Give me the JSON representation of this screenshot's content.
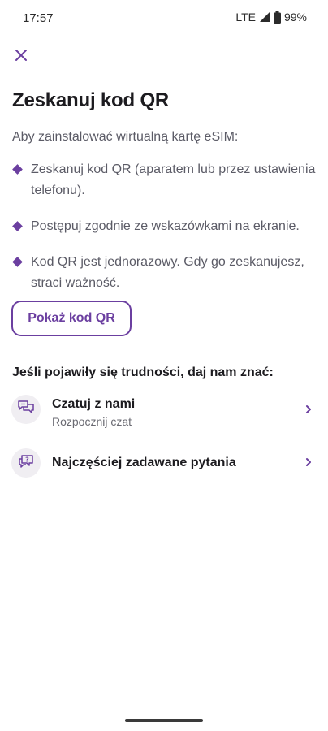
{
  "status_bar": {
    "time": "17:57",
    "network": "LTE",
    "battery": "99%",
    "icons": [
      "signal-icon",
      "battery-icon"
    ]
  },
  "header": {
    "close_icon": "close-icon",
    "title": "Zeskanuj kod QR"
  },
  "instructions": {
    "intro": "Aby zainstalować wirtualną kartę eSIM:",
    "items": [
      "Zeskanuj kod QR (aparatem lub przez ustawienia telefonu).",
      "Postępuj zgodnie ze wskazówkami na ekranie.",
      "Kod QR jest jednorazowy. Gdy go zeskanujesz, straci ważność."
    ]
  },
  "actions": {
    "show_qr_label": "Pokaż kod QR"
  },
  "help": {
    "title": "Jeśli pojawiły się trudności, daj nam znać:",
    "items": [
      {
        "label": "Czatuj z nami",
        "sublabel": "Rozpocznij czat",
        "icon": "chat-bubbles-icon"
      },
      {
        "label": "Najczęściej zadawane pytania",
        "icon": "faq-bubble-icon"
      }
    ]
  },
  "colors": {
    "accent": "#6b3fa0",
    "text_primary": "#1c1b1f",
    "text_secondary": "#5b5b66",
    "icon_bg": "#f0eef2"
  }
}
